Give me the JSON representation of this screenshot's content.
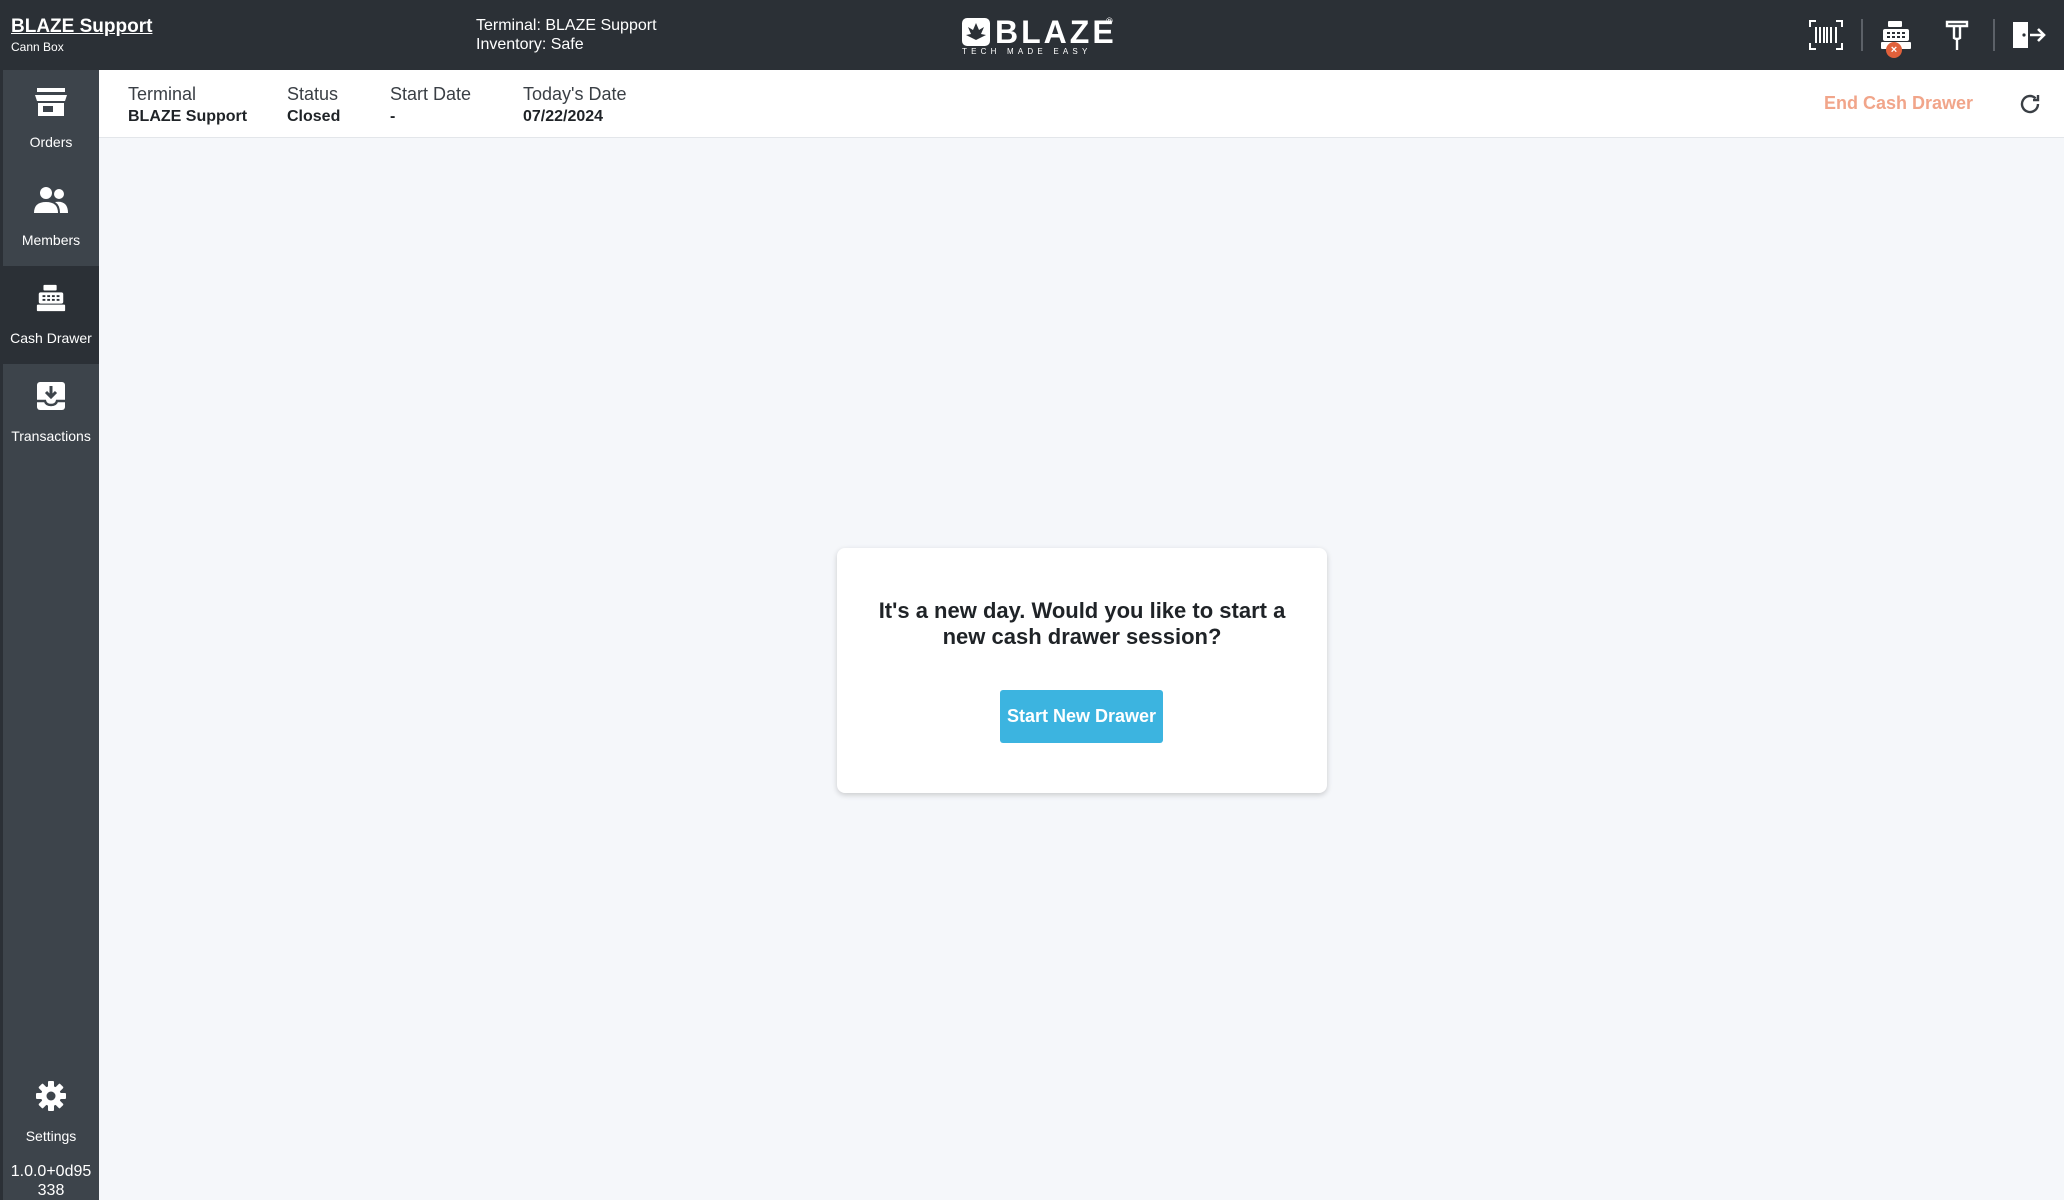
{
  "header": {
    "store_name": "BLAZE Support",
    "store_sub": "Cann Box",
    "terminal_line": "Terminal: BLAZE Support",
    "inventory_line": "Inventory: Safe",
    "logo_word": "BLAZE",
    "logo_reg": "®",
    "logo_tagline": "TECH MADE EASY",
    "printer_status_badge": "×",
    "icons": [
      "barcode-scanner-icon",
      "cash-register-icon",
      "card-reader-icon",
      "logout-icon"
    ]
  },
  "sidebar": {
    "items": [
      {
        "label": "Orders",
        "icon": "store-icon",
        "active": false
      },
      {
        "label": "Members",
        "icon": "people-icon",
        "active": false
      },
      {
        "label": "Cash Drawer",
        "icon": "cash-register-icon",
        "active": true
      },
      {
        "label": "Transactions",
        "icon": "inbox-download-icon",
        "active": false
      }
    ],
    "settings_label": "Settings",
    "version_line1": "1.0.0+0d95",
    "version_line2": "338"
  },
  "infobar": {
    "terminal_label": "Terminal",
    "terminal_value": "BLAZE Support",
    "status_label": "Status",
    "status_value": "Closed",
    "start_date_label": "Start Date",
    "start_date_value": "-",
    "today_label": "Today's Date",
    "today_value": "07/22/2024",
    "end_drawer_label": "End Cash Drawer"
  },
  "dialog": {
    "message": "It's a new day. Would you like to start a new cash drawer session?",
    "button_label": "Start New Drawer"
  },
  "colors": {
    "topbar": "#2b3036",
    "sidebar": "#3d444b",
    "accent_button": "#3cb4e0",
    "end_drawer_text": "#f1a58a",
    "error_badge": "#e0603b"
  }
}
